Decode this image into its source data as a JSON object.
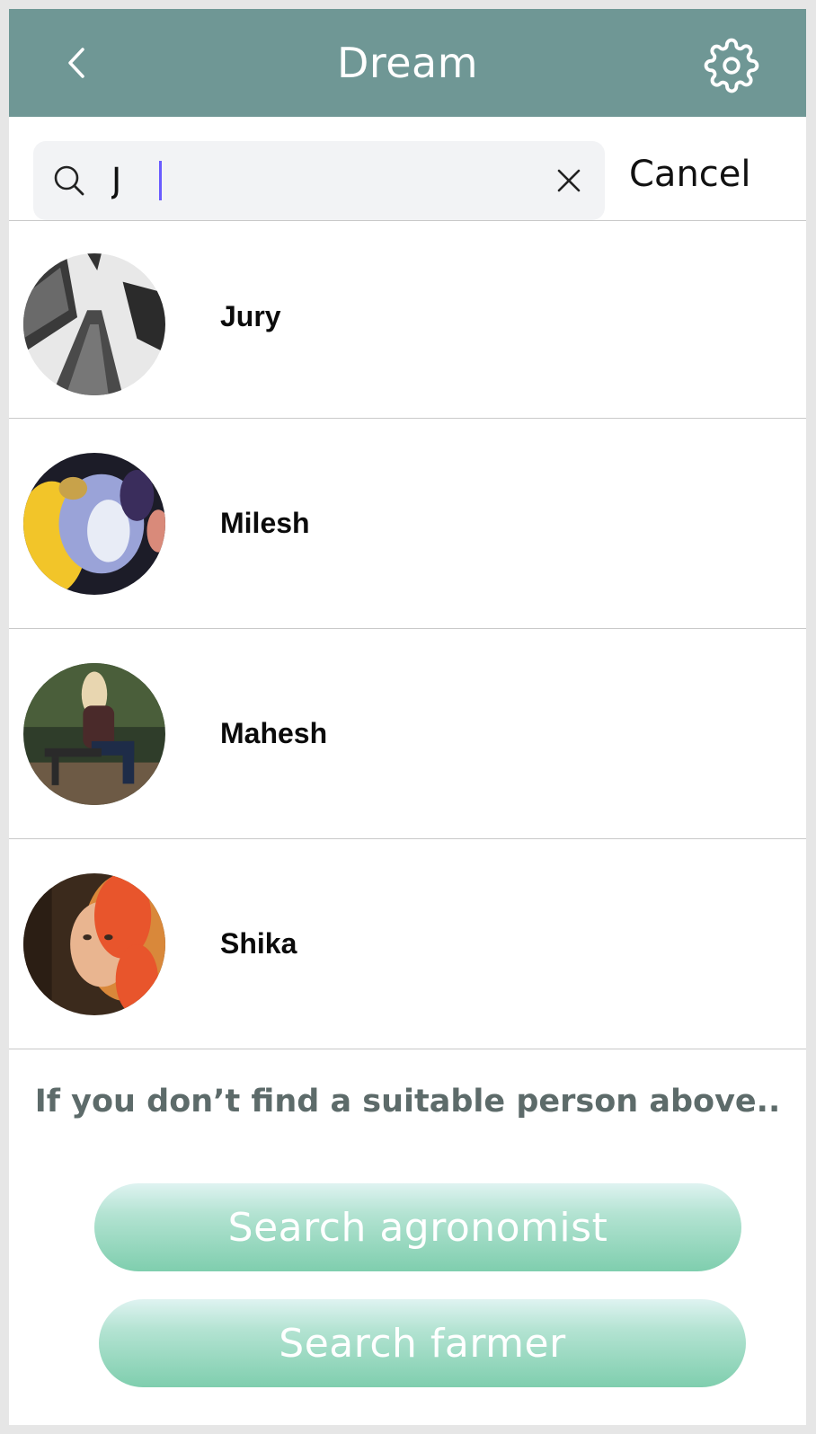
{
  "header": {
    "title": "Dream",
    "back_icon": "chevron-left-icon",
    "settings_icon": "gear-icon",
    "background": "#6f9795"
  },
  "search": {
    "value": "J",
    "cancel_label": "Cancel",
    "search_icon": "search-icon",
    "clear_icon": "close-icon",
    "caret_color": "#6a5cff"
  },
  "results": [
    {
      "name": "Jury"
    },
    {
      "name": "Milesh"
    },
    {
      "name": "Mahesh"
    },
    {
      "name": "Shika"
    }
  ],
  "footer": {
    "hint": "If you don’t find a suitable person above..",
    "search_agronomist_label": "Search agronomist",
    "search_farmer_label": "Search farmer",
    "button_color": "#7fceae"
  }
}
